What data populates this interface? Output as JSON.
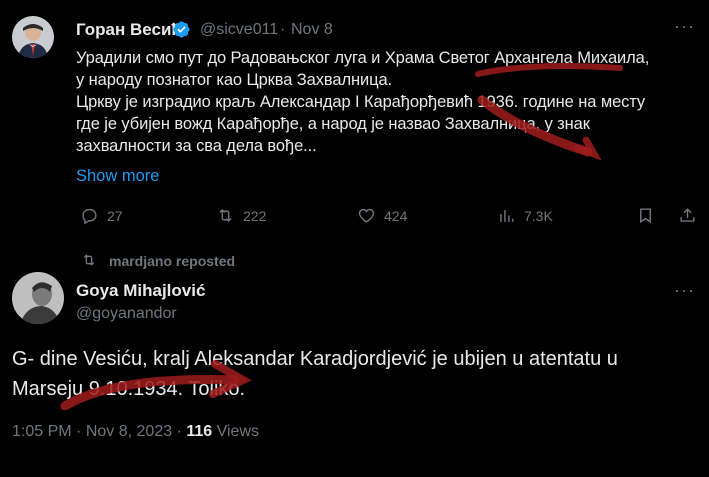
{
  "tweet1": {
    "author_name": "Горан Весић",
    "author_handle": "@sicve011",
    "separator": "·",
    "date": "Nov 8",
    "lines": [
      "Урадили смо пут до Радовањског луга и Храма Светог Архангела Михаила,",
      "у народу познатог као Црква Захвалница.",
      "Цркву је изградио краљ Александар I Карађорђевић 1936. године на месту",
      "где је убијен вожд Карађорђе, а народ је назвао Захвалница, у знак",
      "захвалности за сва дела вође..."
    ],
    "show_more": "Show more",
    "replies": "27",
    "reposts": "222",
    "likes": "424",
    "views": "7.3K",
    "more": "···"
  },
  "repost_banner": {
    "text": "mardjano reposted"
  },
  "tweet2": {
    "author_name": "Goya Mihajlović",
    "author_handle": "@goyanandor",
    "more": "···",
    "lines": [
      "G- dine Vesiću, kralj Aleksandar Karadjordjević je ubijen u atentatu u",
      "Marseju 9.10.1934. Toliko."
    ],
    "time": "1:05 PM",
    "date": "Nov 8, 2023",
    "separator": "·",
    "views_count": "116",
    "views_label": "Views"
  },
  "colors": {
    "background": "#000000",
    "text": "#e7e9ea",
    "muted": "#71767b",
    "link": "#1d9bf0",
    "verified": "#1d9bf0",
    "annotation": "#a01c1c"
  }
}
